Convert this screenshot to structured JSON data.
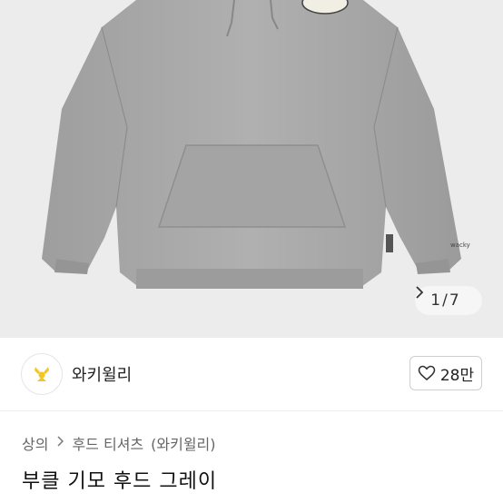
{
  "gallery": {
    "current_page": "1",
    "total_pages": "7",
    "next_icon": "chevron-right-icon"
  },
  "shop": {
    "name": "와키윌리",
    "logo_icon": "wacky-willy-logo",
    "like_count": "28만",
    "like_icon": "heart-outline-icon"
  },
  "breadcrumb": {
    "level1": "상의",
    "level2": "후드 티셔츠",
    "level2_brand": "(와키윌리)",
    "separator_icon": "chevron-right-icon"
  },
  "product": {
    "title": "부클 기모 후드 그레이",
    "image_label": "wacky"
  },
  "colors": {
    "gallery_bg": "#ececec",
    "hoodie_gray": "#a9a9a9",
    "logo_yellow": "#f3c623"
  }
}
